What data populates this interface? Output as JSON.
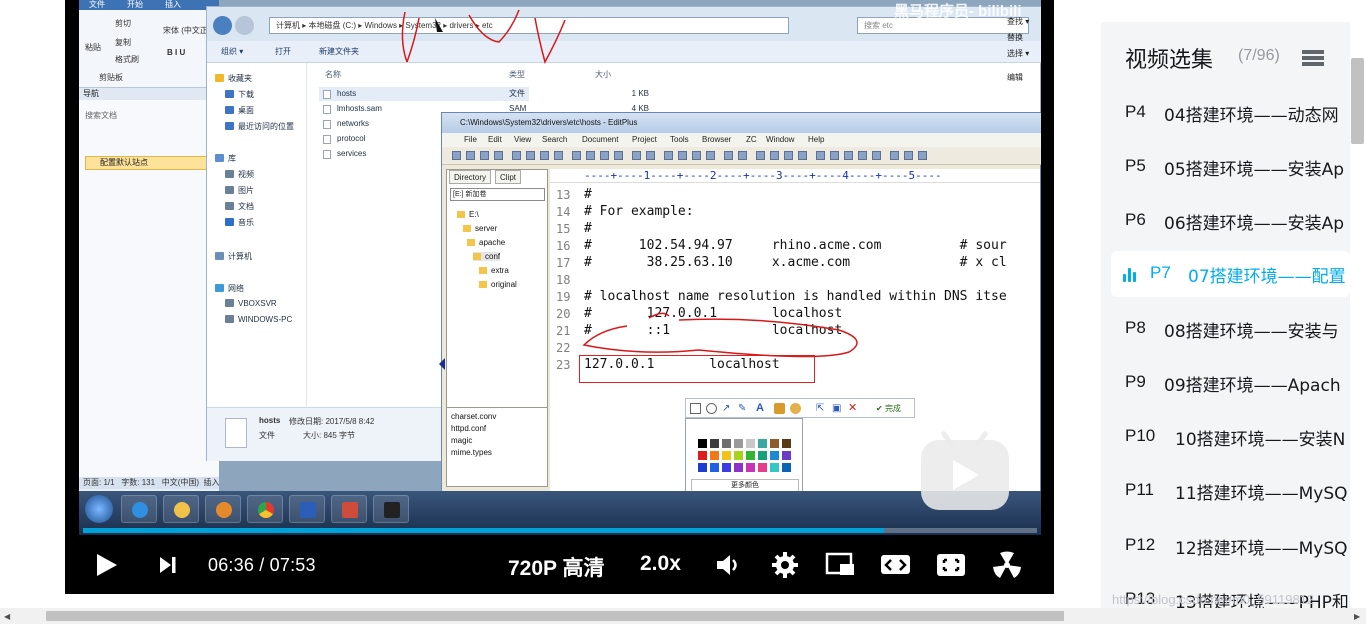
{
  "player": {
    "current_time": "06:36",
    "separator": "/",
    "duration": "07:53",
    "quality": "720P 高清",
    "speed": "2.0x",
    "progress_fraction": 0.84,
    "watermark": "黑马程序员- bilibili",
    "accent": "#00a1d6"
  },
  "video_frame": {
    "word": {
      "tabs": [
        "文件",
        "开始",
        "插入"
      ],
      "clipboard": [
        "剪切",
        "复制",
        "格式刷"
      ],
      "paste": "粘贴",
      "font": "宋体 (中文正",
      "group": "剪贴板",
      "nav_header": "导航",
      "search_doc": "搜索文档",
      "site_item": "配置默认站点",
      "status": [
        "页面: 1/1",
        "字数: 131",
        "中文(中国)",
        "插入"
      ]
    },
    "explorer": {
      "address": [
        "计算机",
        "本地磁盘 (C:)",
        "Windows",
        "System32",
        "drivers",
        "etc"
      ],
      "search_placeholder": "搜索 etc",
      "toolbar": [
        "组织 ▾",
        "打开",
        "新建文件夹"
      ],
      "nav_items": [
        "收藏夹",
        "下载",
        "桌面",
        "最近访问的位置",
        "库",
        "视频",
        "图片",
        "文档",
        "音乐",
        "计算机",
        "网络",
        "VBOXSVR",
        "WINDOWS-PC"
      ],
      "columns": [
        "名称",
        "类型",
        "大小"
      ],
      "files": [
        {
          "name": "hosts",
          "type": "文件",
          "size": "1 KB"
        },
        {
          "name": "lmhosts.sam",
          "type": "SAM 文件",
          "size": "4 KB"
        },
        {
          "name": "networks",
          "type": "",
          "size": ""
        },
        {
          "name": "protocol",
          "type": "",
          "size": ""
        },
        {
          "name": "services",
          "type": "",
          "size": ""
        }
      ],
      "details": {
        "name": "hosts",
        "modified": "修改日期: 2017/5/8 8:42",
        "type": "文件",
        "size": "大小: 845 字节"
      },
      "right_ribbon": [
        "查找 ▾",
        "替换",
        "选择 ▾",
        "编辑"
      ]
    },
    "editplus": {
      "title": "C:\\Windows\\System32\\drivers\\etc\\hosts - EditPlus",
      "menu": [
        "File",
        "Edit",
        "View",
        "Search",
        "Document",
        "Project",
        "Tools",
        "Browser",
        "ZC",
        "Window",
        "Help"
      ],
      "dir_tabs": [
        "Directory",
        "Clipt"
      ],
      "drive": "[E:] 新加卷",
      "tree": [
        "E:\\",
        "server",
        "apache",
        "conf",
        "extra",
        "original"
      ],
      "clip_items": [
        "charset.conv",
        "httpd.conf",
        "magic",
        "mime.types"
      ],
      "ruler": "----+----1----+----2----+----3----+----4----+----5----",
      "lines": [
        {
          "n": "13",
          "t": "#"
        },
        {
          "n": "14",
          "t": "# For example:"
        },
        {
          "n": "15",
          "t": "#"
        },
        {
          "n": "16",
          "t": "#      102.54.94.97     rhino.acme.com          # sour"
        },
        {
          "n": "17",
          "t": "#       38.25.63.10     x.acme.com              # x cl"
        },
        {
          "n": "18",
          "t": ""
        },
        {
          "n": "19",
          "t": "# localhost name resolution is handled within DNS itse"
        },
        {
          "n": "20",
          "t": "#       127.0.0.1       localhost"
        },
        {
          "n": "21",
          "t": "#       ::1             localhost"
        },
        {
          "n": "22",
          "t": ""
        },
        {
          "n": "23",
          "t": "127.0.0.1       localhost"
        }
      ]
    },
    "picker": {
      "done": "完成",
      "more_colors": "更多颜色",
      "colors": [
        "#000000",
        "#3c3c3c",
        "#6e6e6e",
        "#9b9b9b",
        "#c8c8c8",
        "#3aa8a0",
        "#8f5a2c",
        "#5a3a14",
        "#e11c1c",
        "#f07a18",
        "#f3c11c",
        "#a8d21c",
        "#32b432",
        "#18a07a",
        "#1c8ad2",
        "#6a3cc8",
        "#1c3cd2",
        "#2060e6",
        "#3c3ce6",
        "#8c32c8",
        "#c832b4",
        "#e63c8c",
        "#32c8c8",
        "#0a64b4"
      ]
    }
  },
  "episodes": {
    "title": "视频选集",
    "count": "(7/96)",
    "items": [
      {
        "code": "P4",
        "name": "04搭建环境——动态网",
        "active": false
      },
      {
        "code": "P5",
        "name": "05搭建环境——安装Ap",
        "active": false
      },
      {
        "code": "P6",
        "name": "06搭建环境——安装Ap",
        "active": false
      },
      {
        "code": "P7",
        "name": "07搭建环境——配置",
        "active": true
      },
      {
        "code": "P8",
        "name": "08搭建环境——安装与",
        "active": false
      },
      {
        "code": "P9",
        "name": "09搭建环境——Apach",
        "active": false
      },
      {
        "code": "P10",
        "name": "10搭建环境——安装N",
        "active": false
      },
      {
        "code": "P11",
        "name": "11搭建环境——MySQ",
        "active": false
      },
      {
        "code": "P12",
        "name": "12搭建环境——MySQ",
        "active": false
      },
      {
        "code": "P13",
        "name": "13搭建环境——PHP和",
        "active": false
      }
    ],
    "active_color": "#00aeec"
  },
  "footer": {
    "watermark": "https://blog.csdn.net/m0_59119812"
  }
}
